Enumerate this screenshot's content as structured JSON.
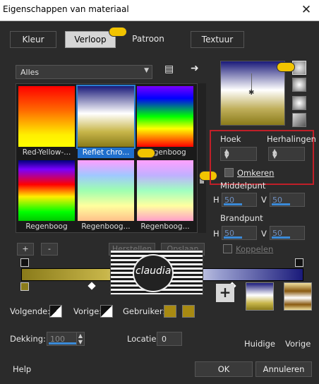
{
  "window": {
    "title": "Eigenschappen van materiaal"
  },
  "tabs": [
    {
      "label": "Kleur",
      "active": false
    },
    {
      "label": "Verloop",
      "active": true
    },
    {
      "label": "Patroon",
      "active": false
    },
    {
      "label": "Textuur",
      "active": false
    }
  ],
  "preset_dropdown": {
    "value": "Alles"
  },
  "gallery": {
    "items": [
      {
        "caption": "Red-Yellow-...",
        "selected": false
      },
      {
        "caption": "Reflet chro...",
        "selected": true
      },
      {
        "caption": "Regenboog",
        "selected": false
      },
      {
        "caption": "Regenboog",
        "selected": false
      },
      {
        "caption": "Regenboog...",
        "selected": false
      },
      {
        "caption": "Regenboog...",
        "selected": false
      }
    ]
  },
  "gallery_buttons": {
    "add": "+",
    "remove": "-",
    "restore": "Herstellen",
    "save": "Opslaan"
  },
  "editor": {
    "colors": {
      "start": "#8a7b1a",
      "mid": "#ffffff",
      "end": "#1a1a7a"
    }
  },
  "bottom": {
    "next_label": "Volgende:",
    "prev_label": "Vorige:",
    "user_label": "Gebruiker:",
    "user_color": "#a88a12",
    "opacity_label": "Dekking:",
    "opacity_value": "100",
    "location_label": "Locatie:",
    "location_value": "0"
  },
  "settings": {
    "angle_label": "Hoek",
    "angle_value": "0",
    "repeats_label": "Herhalingen",
    "repeats_value": "0",
    "invert_label": "Omkeren",
    "midpoint_label": "Middelpunt",
    "focal_label": "Brandpunt",
    "h_label": "H",
    "v_label": "V",
    "mid_h": "50",
    "mid_v": "50",
    "focal_h": "50",
    "focal_v": "50",
    "link_label": "Koppelen"
  },
  "swatches": {
    "current_label": "Huidige",
    "previous_label": "Vorige"
  },
  "footer": {
    "help": "Help",
    "ok": "OK",
    "cancel": "Annuleren"
  },
  "watermark": {
    "text": "claudia"
  }
}
